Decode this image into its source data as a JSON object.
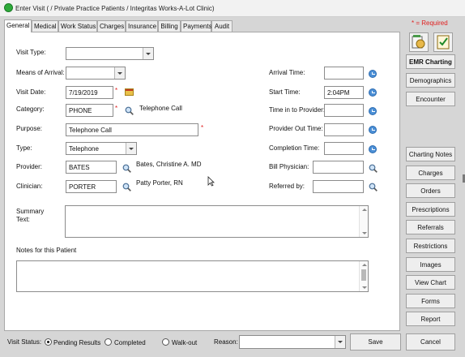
{
  "window": {
    "title": "Enter Visit ( / Private Practice Patients / Integritas Works-A-Lot Clinic)"
  },
  "required_note": "* = Required",
  "tabs": [
    "General",
    "Medical",
    "Work Status",
    "Charges",
    "Insurance",
    "Billing",
    "Payments",
    "Audit"
  ],
  "form": {
    "visit_type": {
      "label": "Visit Type:",
      "value": ""
    },
    "means_of_arrival": {
      "label": "Means of Arrival:",
      "value": ""
    },
    "visit_date": {
      "label": "Visit Date:",
      "value": "7/19/2019"
    },
    "category": {
      "label": "Category:",
      "value": "PHONE",
      "description": "Telephone Call"
    },
    "purpose": {
      "label": "Purpose:",
      "value": "Telephone Call"
    },
    "type": {
      "label": "Type:",
      "value": "Telephone"
    },
    "provider": {
      "label": "Provider:",
      "value": "BATES",
      "description": "Bates, Christine A. MD"
    },
    "clinician": {
      "label": "Clinician:",
      "value": "PORTER",
      "description": "Patty Porter, RN"
    },
    "arrival_time": {
      "label": "Arrival Time:",
      "value": ""
    },
    "start_time": {
      "label": "Start Time:",
      "value": "2:04PM"
    },
    "time_in_to_provider": {
      "label": "Time in to Provider:",
      "value": ""
    },
    "provider_out_time": {
      "label": "Provider Out Time:",
      "value": ""
    },
    "completion_time": {
      "label": "Completion Time:",
      "value": ""
    },
    "bill_physician": {
      "label": "Bill Physician:",
      "value": ""
    },
    "referred_by": {
      "label": "Referred by:",
      "value": ""
    },
    "summary_text": {
      "label_line1": "Summary",
      "label_line2": "Text:",
      "value": ""
    },
    "notes": {
      "label": "Notes for this Patient",
      "value": ""
    },
    "required_mark": "*"
  },
  "sidebar": {
    "buttons": [
      "EMR Charting",
      "Demographics",
      "Encounter",
      "Charting Notes",
      "Charges",
      "Orders",
      "Prescriptions",
      "Referrals",
      "Restrictions",
      "Images",
      "View Chart",
      "Forms",
      "Report"
    ]
  },
  "bottom": {
    "visit_status_label": "Visit Status:",
    "statuses": [
      "Pending Results",
      "Completed",
      "Walk-out"
    ],
    "selected_status": "Pending Results",
    "reason_label": "Reason:",
    "reason_value": "",
    "save": "Save",
    "cancel": "Cancel"
  },
  "colors": {
    "required": "#e02020",
    "accent_icon": "#4b8fd6",
    "title_icon": "#2eaa3a"
  },
  "icons": [
    "emr-charting-icon",
    "check-clipboard-icon",
    "search-icon",
    "clock-icon",
    "calendar-icon"
  ]
}
